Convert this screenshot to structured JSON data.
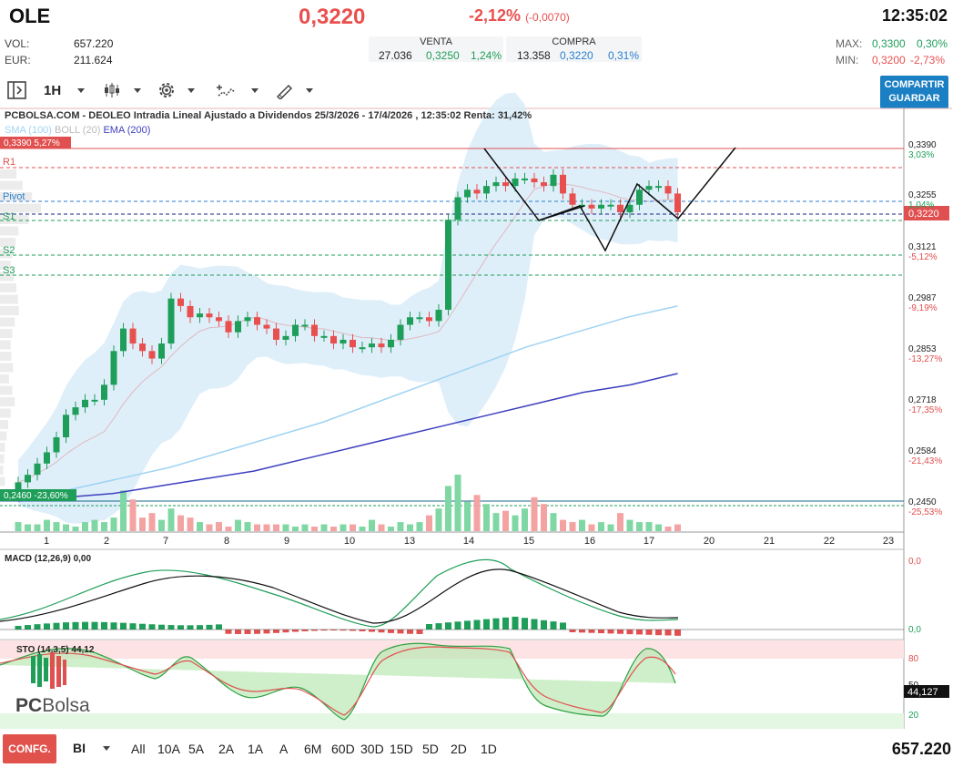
{
  "header": {
    "ticker": "OLE",
    "price": "0,3220",
    "change_pct": "-2,12%",
    "change_abs": "(-0,0070)",
    "time": "12:35:02",
    "vol_label": "VOL:",
    "vol_value": "657.220",
    "eur_label": "EUR:",
    "eur_value": "211.624",
    "venta_label": "VENTA",
    "venta_qty": "27.036",
    "venta_price": "0,3250",
    "venta_pct": "1,24%",
    "compra_label": "COMPRA",
    "compra_qty": "13.358",
    "compra_price": "0,3220",
    "compra_pct": "0,31%",
    "max_label": "MAX:",
    "max_price": "0,3300",
    "max_pct": "0,30%",
    "min_label": "MIN:",
    "min_price": "0,3200",
    "min_pct": "-2,73%"
  },
  "toolbar": {
    "interval": "1H",
    "share_line1": "COMPARTIR",
    "share_line2": "GUARDAR",
    "icons": [
      "panel-toggle-icon",
      "candle-type-icon",
      "gear-icon",
      "indicators-icon",
      "draw-tool-icon"
    ]
  },
  "chart": {
    "title": "PCBOLSA.COM - DEOLEO Intradia Lineal Ajustado a Dividendos 25/3/2026 - 17/4/2026 , 12:35:02 Renta: 31,42%",
    "sma_label": "SMA (100)",
    "boll_label": "BOLL (20)",
    "ema_label": "EMA (200)",
    "top_tag": "0,3390",
    "top_tag_pct": "5,27%",
    "bottom_tag": "0,2460",
    "bottom_tag_pct": "-23,60%",
    "pivot_labels": [
      "R1",
      "Pivot",
      "S1",
      "S2",
      "S3"
    ],
    "price_labels": [
      "0,3390",
      "3,03%",
      "0,3255",
      "1,04%",
      "0,3220",
      "0,3121",
      "-5,12%",
      "0,2987",
      "-9,19%",
      "0,2853",
      "-13,27%",
      "0,2718",
      "-17,35%",
      "0,2584",
      "-21,43%",
      "0,2450",
      "-25,53%"
    ],
    "x_labels": [
      "1",
      "2",
      "7",
      "8",
      "9",
      "10",
      "13",
      "14",
      "15",
      "16",
      "17",
      "20",
      "21",
      "22",
      "23"
    ],
    "macd_label": "MACD (12,26,9)",
    "macd_value": "0,00",
    "macd_axis_top": "0,0",
    "macd_axis_bottom": "0,0",
    "sto_label": "STO (14,3,5)",
    "sto_value": "44,12",
    "sto_axis": [
      "80",
      "50",
      "20"
    ],
    "sto_current": "44,127",
    "colors": {
      "up": "#1f9e59",
      "down": "#e8504f",
      "boll": "#cfe6f7",
      "sma": "#9fd3f2",
      "ema": "#3d3fbf"
    }
  },
  "chart_data": {
    "type": "candlestick",
    "title": "PCBOLSA.COM - DEOLEO Intradia Lineal Ajustado a Dividendos 25/3/2026 - 17/4/2026 , 12:35:02 Renta: 31,42%",
    "x_days": [
      "1",
      "2",
      "7",
      "8",
      "9",
      "10",
      "13",
      "14",
      "15",
      "16",
      "17"
    ],
    "ylim": [
      0.245,
      0.339
    ],
    "close": [
      0.25,
      0.252,
      0.255,
      0.258,
      0.262,
      0.268,
      0.27,
      0.272,
      0.272,
      0.276,
      0.285,
      0.291,
      0.287,
      0.285,
      0.283,
      0.287,
      0.299,
      0.297,
      0.294,
      0.295,
      0.294,
      0.293,
      0.29,
      0.293,
      0.294,
      0.292,
      0.291,
      0.288,
      0.289,
      0.292,
      0.292,
      0.289,
      0.289,
      0.287,
      0.288,
      0.286,
      0.286,
      0.287,
      0.286,
      0.288,
      0.292,
      0.294,
      0.294,
      0.293,
      0.296,
      0.32,
      0.326,
      0.328,
      0.327,
      0.329,
      0.33,
      0.329,
      0.331,
      0.331,
      0.33,
      0.329,
      0.332,
      0.327,
      0.324,
      0.324,
      0.323,
      0.324,
      0.324,
      0.322,
      0.324,
      0.328,
      0.329,
      0.329,
      0.327,
      0.322
    ],
    "volume": [
      4,
      3,
      3,
      5,
      4,
      3,
      2,
      4,
      5,
      4,
      6,
      18,
      14,
      6,
      8,
      5,
      10,
      7,
      6,
      4,
      3,
      4,
      2,
      5,
      4,
      3,
      3,
      3,
      3,
      2,
      3,
      2,
      3,
      2,
      3,
      3,
      2,
      5,
      3,
      2,
      4,
      3,
      4,
      7,
      10,
      20,
      25,
      13,
      16,
      12,
      8,
      9,
      7,
      10,
      15,
      12,
      8,
      5,
      4,
      5,
      3,
      4,
      3,
      8,
      5,
      4,
      4,
      3,
      2,
      3
    ],
    "ema_200": [
      0.245,
      0.246,
      0.247,
      0.249,
      0.251,
      0.253,
      0.256,
      0.259,
      0.262,
      0.265,
      0.268,
      0.271,
      0.274,
      0.276,
      0.279
    ],
    "sma_100": [
      0.245,
      0.248,
      0.251,
      0.254,
      0.258,
      0.262,
      0.266,
      0.271,
      0.276,
      0.281,
      0.286,
      0.29,
      0.294,
      0.297
    ]
  }
}
